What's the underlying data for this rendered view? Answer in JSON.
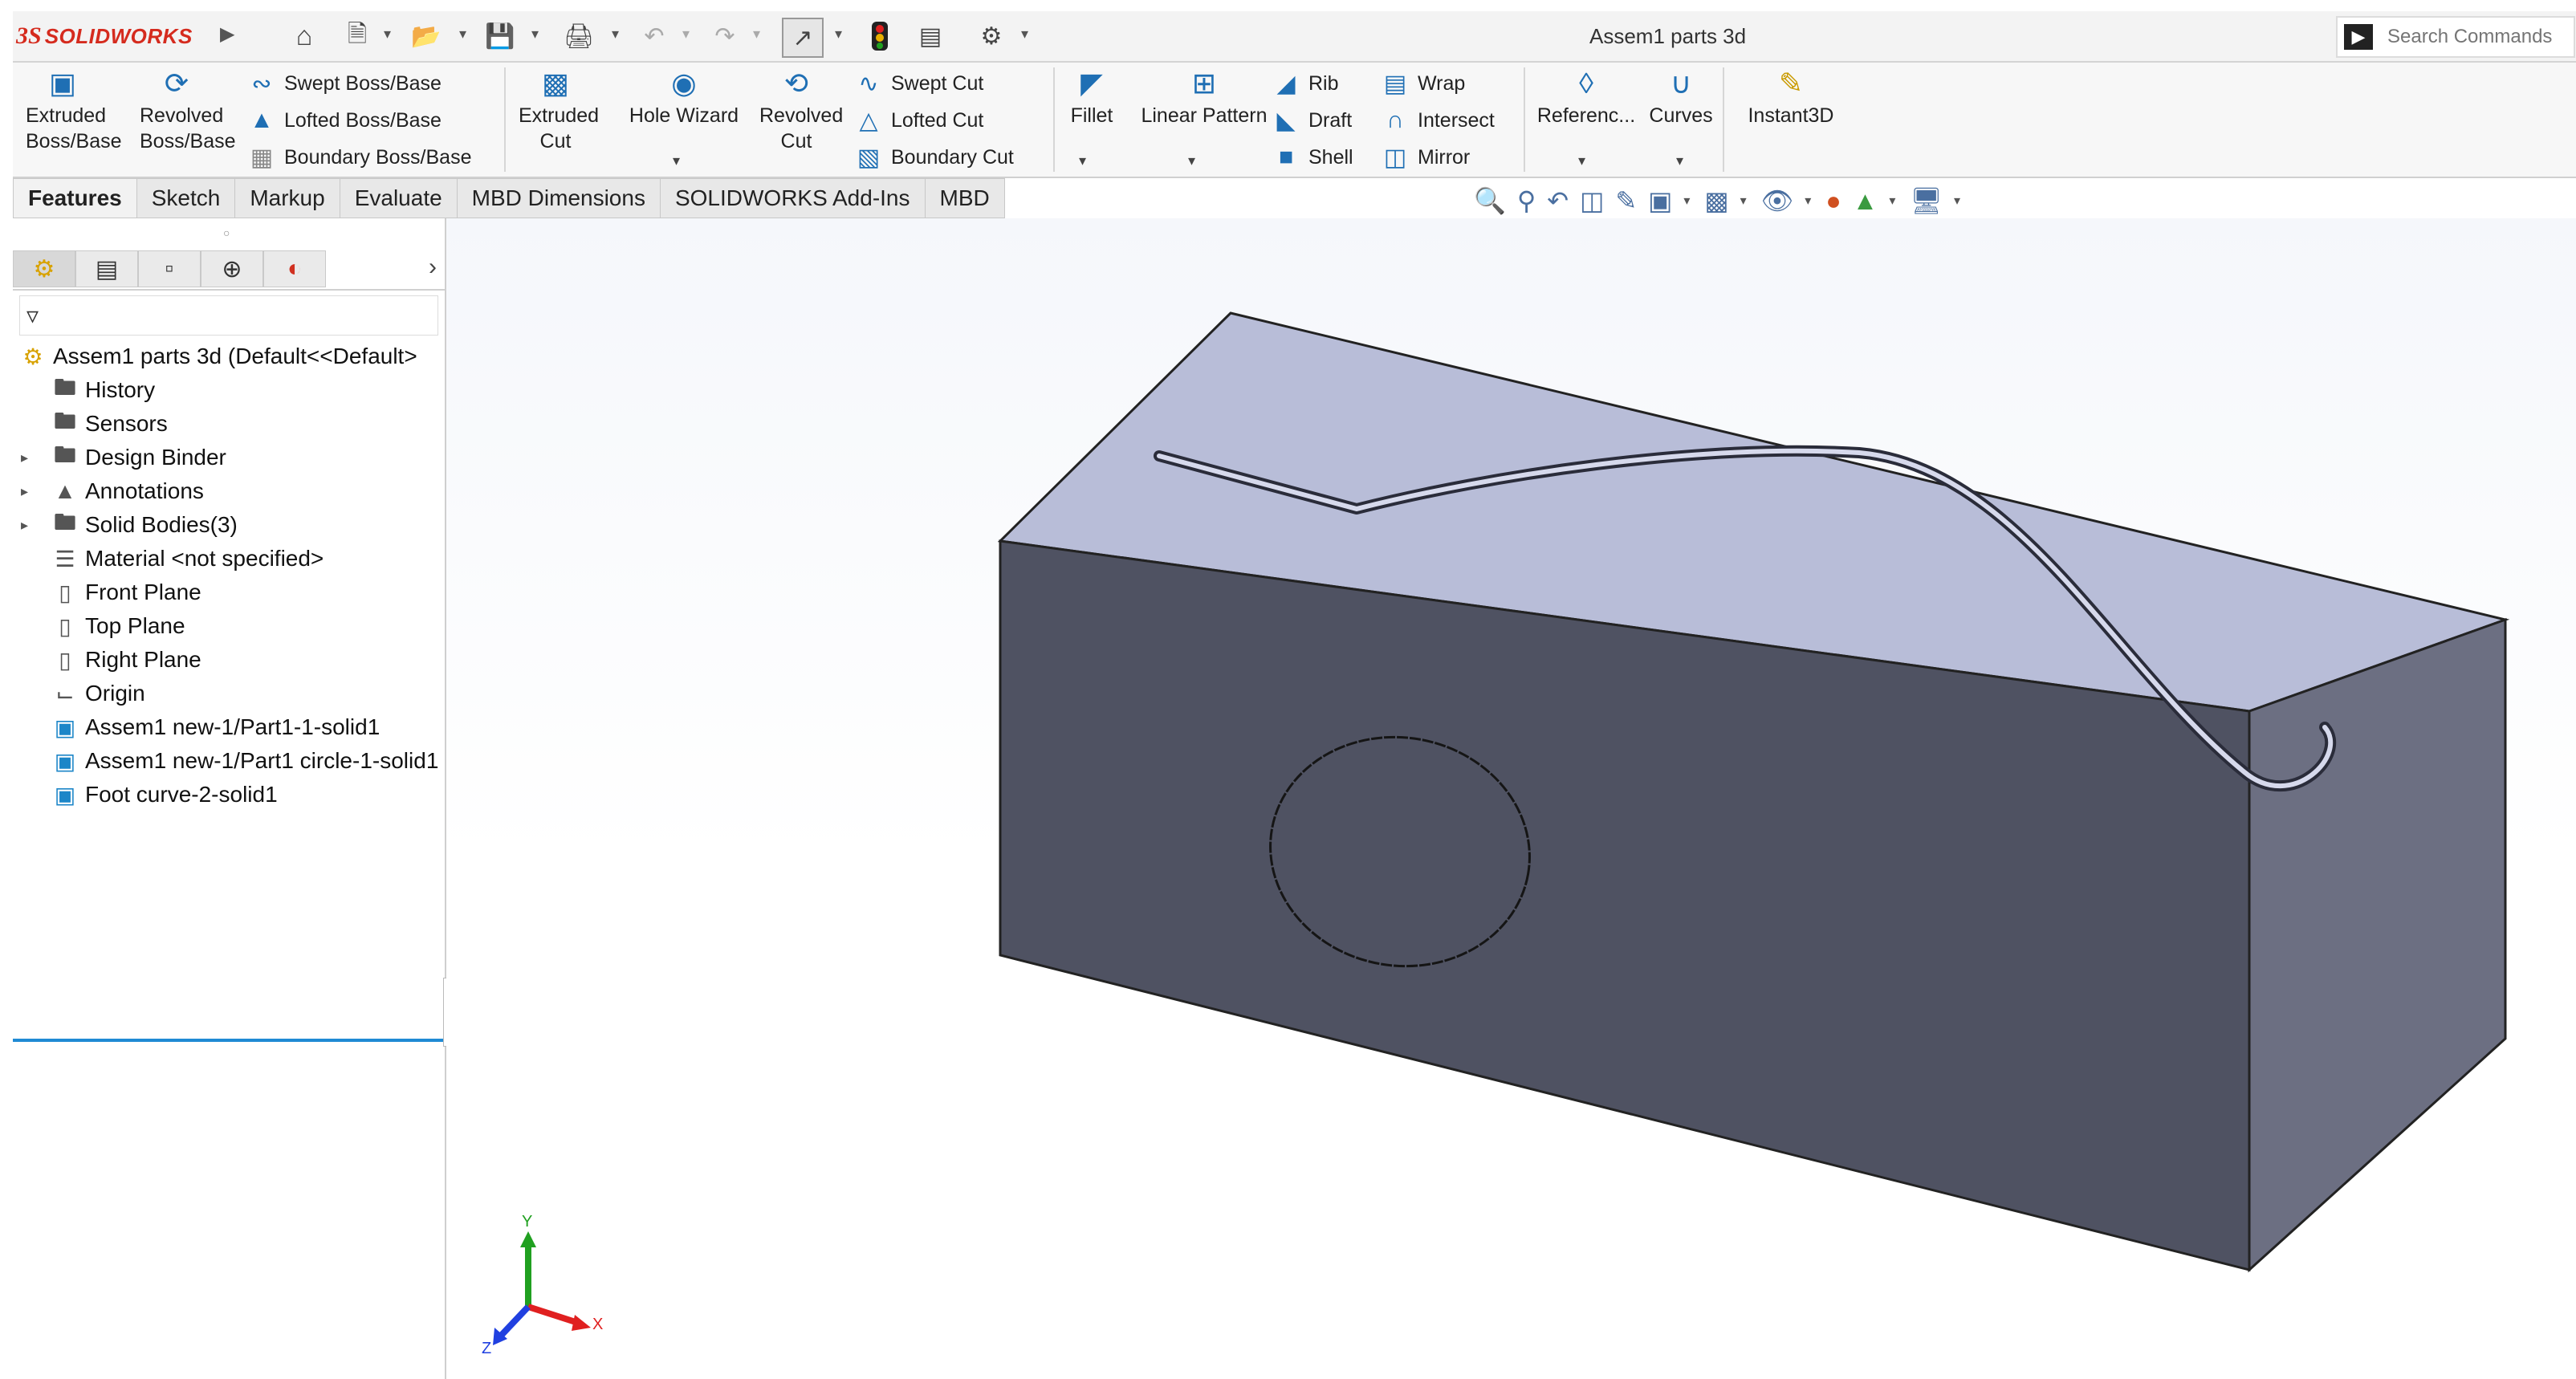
{
  "app": {
    "brand_prefix": "3S",
    "brand_name": "SOLIDWORKS",
    "document_title": "Assem1 parts 3d"
  },
  "quick_access": {
    "icons": [
      "home-icon",
      "new-document-icon",
      "open-icon",
      "save-icon",
      "print-icon",
      "undo-icon",
      "redo-icon",
      "select-icon",
      "rebuild-icon",
      "file-properties-icon",
      "options-icon"
    ]
  },
  "search": {
    "placeholder": "Search Commands"
  },
  "ribbon": {
    "extruded_boss": "Extruded Boss/Base",
    "revolved_boss": "Revolved Boss/Base",
    "swept_boss": "Swept Boss/Base",
    "lofted_boss": "Lofted Boss/Base",
    "boundary_boss": "Boundary Boss/Base",
    "extruded_cut": "Extruded Cut",
    "hole_wizard": "Hole Wizard",
    "revolved_cut": "Revolved Cut",
    "swept_cut": "Swept Cut",
    "lofted_cut": "Lofted Cut",
    "boundary_cut": "Boundary Cut",
    "fillet": "Fillet",
    "linear_pattern": "Linear Pattern",
    "rib": "Rib",
    "draft": "Draft",
    "shell": "Shell",
    "wrap": "Wrap",
    "intersect": "Intersect",
    "mirror": "Mirror",
    "reference": "Referenc...",
    "curves": "Curves",
    "instant3d": "Instant3D"
  },
  "tabs": [
    "Features",
    "Sketch",
    "Markup",
    "Evaluate",
    "MBD Dimensions",
    "SOLIDWORKS Add-Ins",
    "MBD"
  ],
  "active_tab": "Features",
  "feature_tree": {
    "root": "Assem1 parts 3d  (Default<<Default>",
    "items": [
      {
        "label": "History",
        "icon": "history-folder-icon",
        "expandable": false
      },
      {
        "label": "Sensors",
        "icon": "sensors-folder-icon",
        "expandable": false
      },
      {
        "label": "Design Binder",
        "icon": "design-binder-icon",
        "expandable": true
      },
      {
        "label": "Annotations",
        "icon": "annotations-icon",
        "expandable": true
      },
      {
        "label": "Solid Bodies(3)",
        "icon": "solid-bodies-folder-icon",
        "expandable": true
      },
      {
        "label": "Material <not specified>",
        "icon": "material-icon",
        "expandable": false
      },
      {
        "label": "Front Plane",
        "icon": "plane-icon",
        "expandable": false
      },
      {
        "label": "Top Plane",
        "icon": "plane-icon",
        "expandable": false
      },
      {
        "label": "Right Plane",
        "icon": "plane-icon",
        "expandable": false
      },
      {
        "label": "Origin",
        "icon": "origin-icon",
        "expandable": false
      },
      {
        "label": "Assem1 new-1/Part1-1-solid1",
        "icon": "solid-body-icon",
        "expandable": false
      },
      {
        "label": "Assem1 new-1/Part1 circle-1-solid1",
        "icon": "solid-body-icon",
        "expandable": false
      },
      {
        "label": "Foot curve-2-solid1",
        "icon": "solid-body-icon",
        "expandable": false
      }
    ]
  },
  "triad": {
    "x": "X",
    "y": "Y",
    "z": "Z"
  },
  "colors": {
    "brand_red": "#d52b1e",
    "icon_blue": "#1f6fb4",
    "box_top": "#b8bdd8",
    "box_front": "#4f5262",
    "box_side": "#6c6f82",
    "axis_x": "#e02020",
    "axis_y": "#20a020",
    "axis_z": "#2040e0"
  }
}
